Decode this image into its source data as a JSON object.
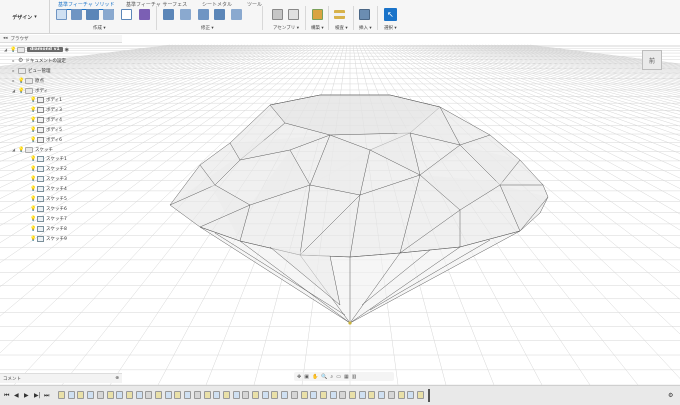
{
  "workspace": {
    "label": "デザイン"
  },
  "tabs": [
    {
      "label": "基準フィーチャ ソリッド",
      "active": true
    },
    {
      "label": "基準フィーチャ サーフェス",
      "active": false
    },
    {
      "label": "シートメタル",
      "active": false
    },
    {
      "label": "ツール",
      "active": false
    }
  ],
  "toolbar_groups": [
    {
      "label": "作成 ▾"
    },
    {
      "label": "修正 ▾"
    },
    {
      "label": "アセンブリ ▾"
    },
    {
      "label": "構築 ▾"
    },
    {
      "label": "検査 ▾"
    },
    {
      "label": "挿入 ▾"
    },
    {
      "label": "選択 ▾"
    }
  ],
  "browser": {
    "title": "ブラウザ",
    "root": "diamond v1",
    "items": [
      {
        "label": "ドキュメントの設定",
        "level": 1
      },
      {
        "label": "ビュー管理",
        "level": 1
      },
      {
        "label": "原点",
        "level": 1
      },
      {
        "label": "ボディ",
        "level": 1
      },
      {
        "label": "ボディ1",
        "level": 2
      },
      {
        "label": "ボディ3",
        "level": 2
      },
      {
        "label": "ボディ4",
        "level": 2
      },
      {
        "label": "ボディ5",
        "level": 2
      },
      {
        "label": "ボディ6",
        "level": 2
      },
      {
        "label": "スケッチ",
        "level": 1
      },
      {
        "label": "スケッチ1",
        "level": 2
      },
      {
        "label": "スケッチ2",
        "level": 2
      },
      {
        "label": "スケッチ3",
        "level": 2
      },
      {
        "label": "スケッチ4",
        "level": 2
      },
      {
        "label": "スケッチ5",
        "level": 2
      },
      {
        "label": "スケッチ6",
        "level": 2
      },
      {
        "label": "スケッチ7",
        "level": 2
      },
      {
        "label": "スケッチ8",
        "level": 2
      },
      {
        "label": "スケッチ9",
        "level": 2
      }
    ]
  },
  "viewcube": {
    "label": "前"
  },
  "comments": {
    "label": "コメント"
  },
  "colors": {
    "accent": "#1a73c9",
    "grid": "#d0d0d0",
    "diamond_edge": "#444444"
  }
}
